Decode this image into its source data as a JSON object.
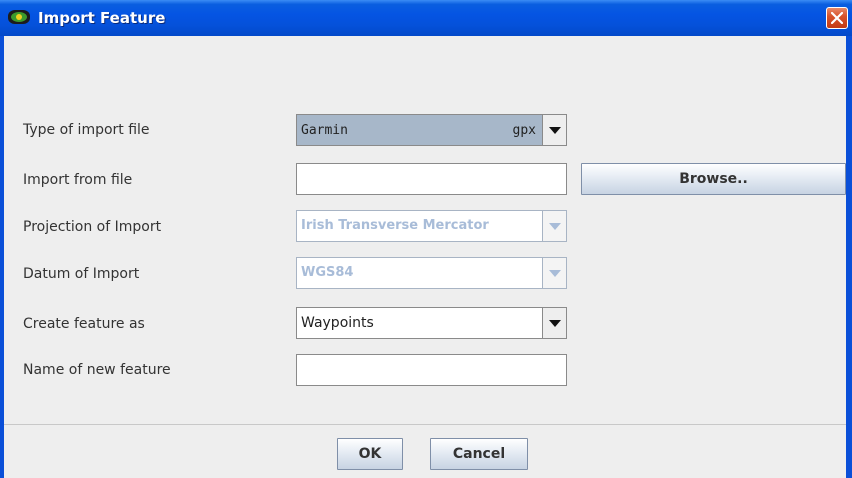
{
  "window": {
    "title": "Import Feature",
    "icon": "eye-app-icon",
    "close_icon": "close-icon",
    "titlebar_color": "#0554e3",
    "close_color": "#d8542c"
  },
  "form": {
    "rows": [
      {
        "label": "Type of import file"
      },
      {
        "label": "Import from file"
      },
      {
        "label": "Projection of Import"
      },
      {
        "label": "Datum of Import"
      },
      {
        "label": "Create feature as"
      },
      {
        "label": "Name of new feature"
      }
    ],
    "import_type": {
      "value": "Garmin",
      "extension": "gpx"
    },
    "import_file": {
      "value": ""
    },
    "projection": {
      "value": "Irish Transverse Mercator",
      "enabled": false
    },
    "datum": {
      "value": "WGS84",
      "enabled": false
    },
    "feature_type": {
      "value": "Waypoints"
    },
    "feature_name": {
      "value": ""
    },
    "browse_label": "Browse.."
  },
  "footer": {
    "ok_label": "OK",
    "cancel_label": "Cancel"
  }
}
